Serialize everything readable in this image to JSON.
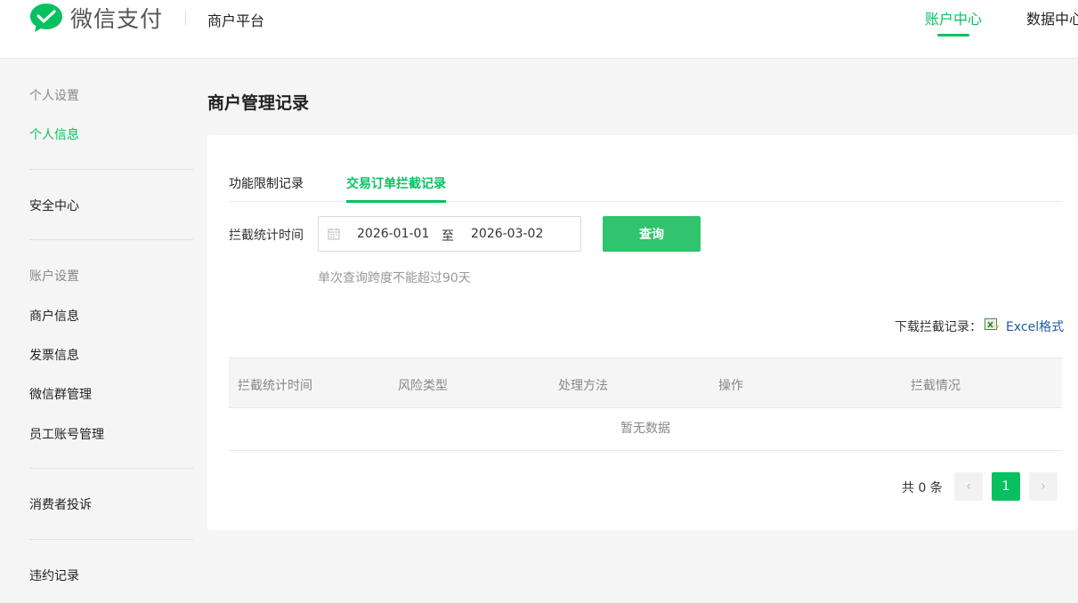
{
  "header": {
    "logo_text": "微信支付",
    "platform": "商户平台",
    "nav": [
      {
        "label": "账户中心",
        "active": true
      },
      {
        "label": "数据中心",
        "active": false
      }
    ]
  },
  "sidebar": {
    "groups": [
      {
        "title": "个人设置",
        "items": [
          "个人信息"
        ]
      },
      {
        "title": "",
        "items": [
          "安全中心"
        ]
      },
      {
        "title": "账户设置",
        "items": [
          "商户信息",
          "发票信息",
          "微信群管理",
          "员工账号管理"
        ]
      },
      {
        "title": "",
        "items": [
          "消费者投诉"
        ]
      },
      {
        "title": "",
        "items": [
          "违约记录"
        ]
      }
    ],
    "active_item": "个人信息"
  },
  "main": {
    "title": "商户管理记录",
    "tabs": [
      {
        "label": "功能限制记录",
        "active": false
      },
      {
        "label": "交易订单拦截记录",
        "active": true
      }
    ],
    "filter": {
      "label": "拦截统计时间",
      "start_date": "2026-01-01",
      "separator": "至",
      "end_date": "2026-03-02",
      "query_button": "查询",
      "hint": "单次查询跨度不能超过90天"
    },
    "download": {
      "label": "下载拦截记录：",
      "link": "Excel格式"
    },
    "table": {
      "columns": [
        "拦截统计时间",
        "风险类型",
        "处理方法",
        "操作",
        "拦截情况"
      ],
      "empty_text": "暂无数据"
    },
    "pagination": {
      "total_text": "共 0 条",
      "prev": "‹",
      "current_page": "1",
      "next": "›"
    }
  },
  "colors": {
    "accent": "#07c160",
    "button": "#2fc46d",
    "link": "#1e5aa8"
  }
}
